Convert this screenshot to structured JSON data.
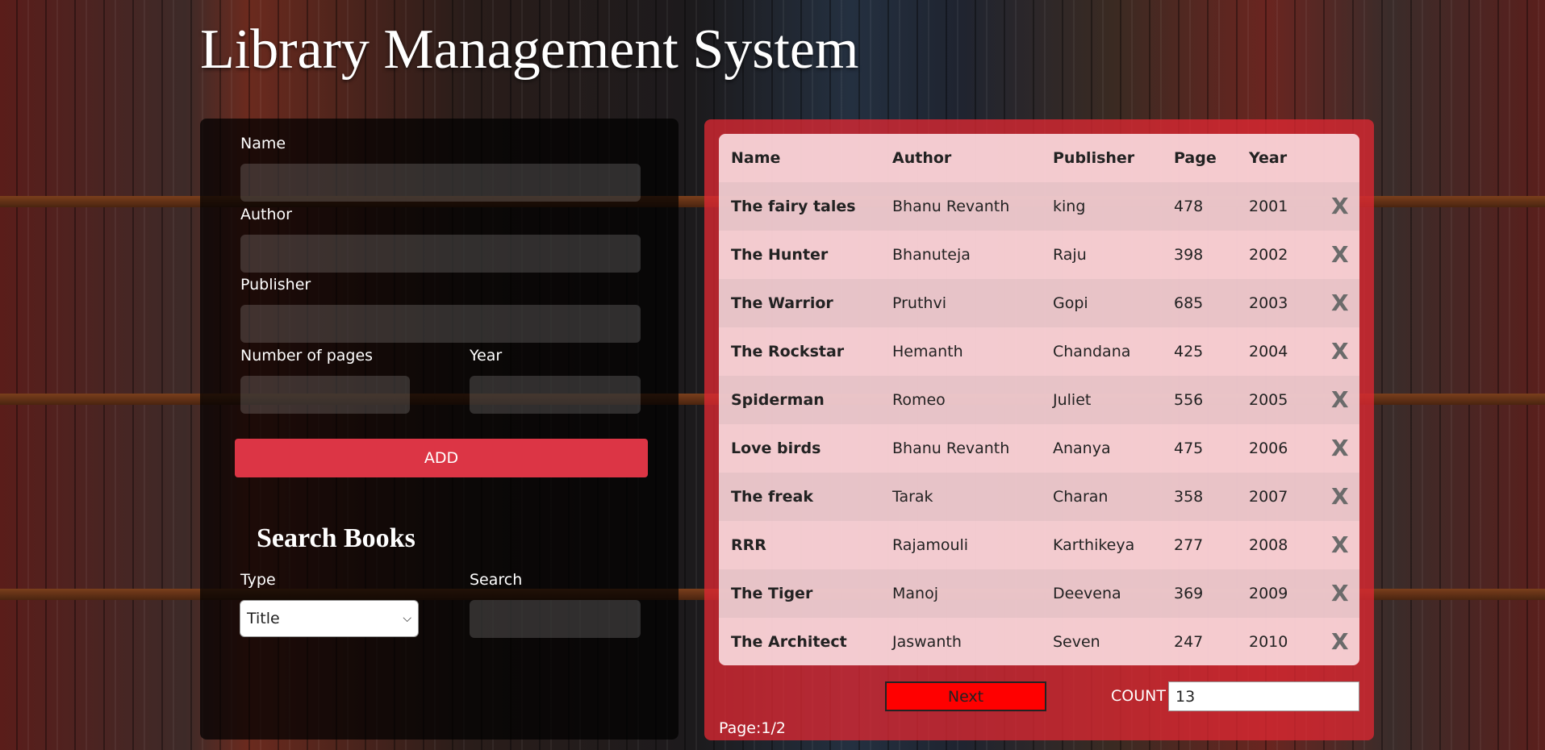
{
  "app": {
    "title": "Library Management System"
  },
  "form": {
    "name_label": "Name",
    "name_value": "",
    "author_label": "Author",
    "author_value": "",
    "publisher_label": "Publisher",
    "publisher_value": "",
    "pages_label": "Number of pages",
    "pages_value": "",
    "year_label": "Year",
    "year_value": "",
    "add_label": "ADD"
  },
  "search": {
    "heading": "Search Books",
    "type_label": "Type",
    "type_selected": "Title",
    "search_label": "Search",
    "search_value": ""
  },
  "table": {
    "headers": {
      "name": "Name",
      "author": "Author",
      "publisher": "Publisher",
      "page": "Page",
      "year": "Year"
    },
    "delete_symbol": "X",
    "rows": [
      {
        "name": "The fairy tales",
        "author": "Bhanu Revanth",
        "publisher": "king",
        "page": "478",
        "year": "2001"
      },
      {
        "name": "The Hunter",
        "author": "Bhanuteja",
        "publisher": "Raju",
        "page": "398",
        "year": "2002"
      },
      {
        "name": "The Warrior",
        "author": "Pruthvi",
        "publisher": "Gopi",
        "page": "685",
        "year": "2003"
      },
      {
        "name": "The Rockstar",
        "author": "Hemanth",
        "publisher": "Chandana",
        "page": "425",
        "year": "2004"
      },
      {
        "name": "Spiderman",
        "author": "Romeo",
        "publisher": "Juliet",
        "page": "556",
        "year": "2005"
      },
      {
        "name": "Love birds",
        "author": "Bhanu Revanth",
        "publisher": "Ananya",
        "page": "475",
        "year": "2006"
      },
      {
        "name": "The freak",
        "author": "Tarak",
        "publisher": "Charan",
        "page": "358",
        "year": "2007"
      },
      {
        "name": "RRR",
        "author": "Rajamouli",
        "publisher": "Karthikeya",
        "page": "277",
        "year": "2008"
      },
      {
        "name": "The Tiger",
        "author": "Manoj",
        "publisher": "Deevena",
        "page": "369",
        "year": "2009"
      },
      {
        "name": "The Architect",
        "author": "Jaswanth",
        "publisher": "Seven",
        "page": "247",
        "year": "2010"
      }
    ]
  },
  "pagination": {
    "next_label": "Next",
    "count_label": "COUNT",
    "count_value": "13",
    "page_text": "Page:1/2"
  },
  "colors": {
    "add_button": "#dc3545",
    "next_button": "#ff0000",
    "table_panel": "#dc2832"
  }
}
